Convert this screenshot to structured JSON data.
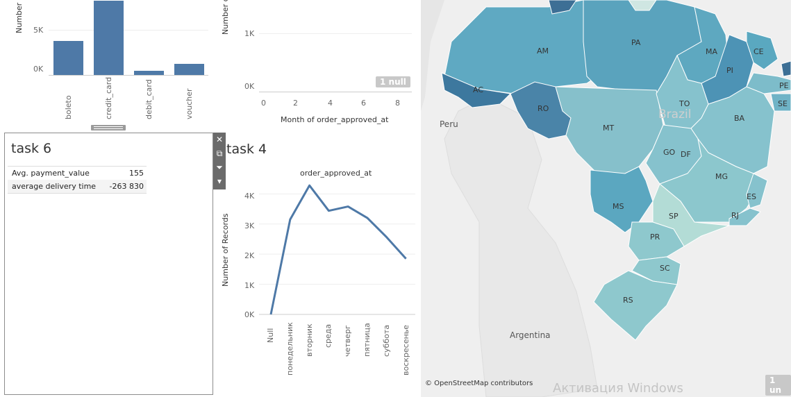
{
  "top_left_chart": {
    "ylabel": "Number",
    "yticks": [
      "5K",
      "0K"
    ],
    "chart_data": {
      "type": "bar",
      "categories": [
        "boleto",
        "credit_card",
        "debit_card",
        "voucher"
      ],
      "values": [
        4000,
        8800,
        500,
        1300
      ],
      "ylabel": "Number",
      "ylim": [
        0,
        8800
      ]
    }
  },
  "top_mid_chart": {
    "ylabel": "Number o",
    "yticks": [
      "1K",
      "0K"
    ],
    "xticks": [
      "0",
      "2",
      "4",
      "6",
      "8"
    ],
    "xlabel": "Month of order_approved_at",
    "null_badge": "1 null"
  },
  "task6": {
    "title": "task 6",
    "rows": [
      {
        "label": "Avg. payment_value",
        "value": "155"
      },
      {
        "label": "average delivery time",
        "value": "-263 830"
      }
    ]
  },
  "task4": {
    "title": "task 4",
    "chart_title": "order_approved_at",
    "ylabel": "Number of Records",
    "yticks": [
      "4K",
      "3K",
      "2K",
      "1K",
      "0K"
    ],
    "chart_data": {
      "type": "line",
      "title": "order_approved_at",
      "ylabel": "Number of Records",
      "categories": [
        "Null",
        "понедельник",
        "вторник",
        "среда",
        "четверг",
        "пятница",
        "суббота",
        "воскресенье"
      ],
      "values": [
        0,
        3150,
        4280,
        3440,
        3580,
        3200,
        2560,
        1850
      ],
      "ylim": [
        0,
        4400
      ]
    }
  },
  "map": {
    "states": [
      "AM",
      "PA",
      "MA",
      "CE",
      "PI",
      "PE",
      "SE",
      "AC",
      "RO",
      "TO",
      "MT",
      "BA",
      "GO",
      "DF",
      "MG",
      "ES",
      "MS",
      "SP",
      "RJ",
      "PR",
      "SC",
      "RS"
    ],
    "countries": [
      "Brazil",
      "Peru",
      "Argentina"
    ],
    "credit": "© OpenStreetMap contributors",
    "null_badge": "1 un",
    "watermark": "Активация Windows"
  },
  "colors": {
    "bar": "#4e79a7",
    "line": "#4e79a7"
  }
}
